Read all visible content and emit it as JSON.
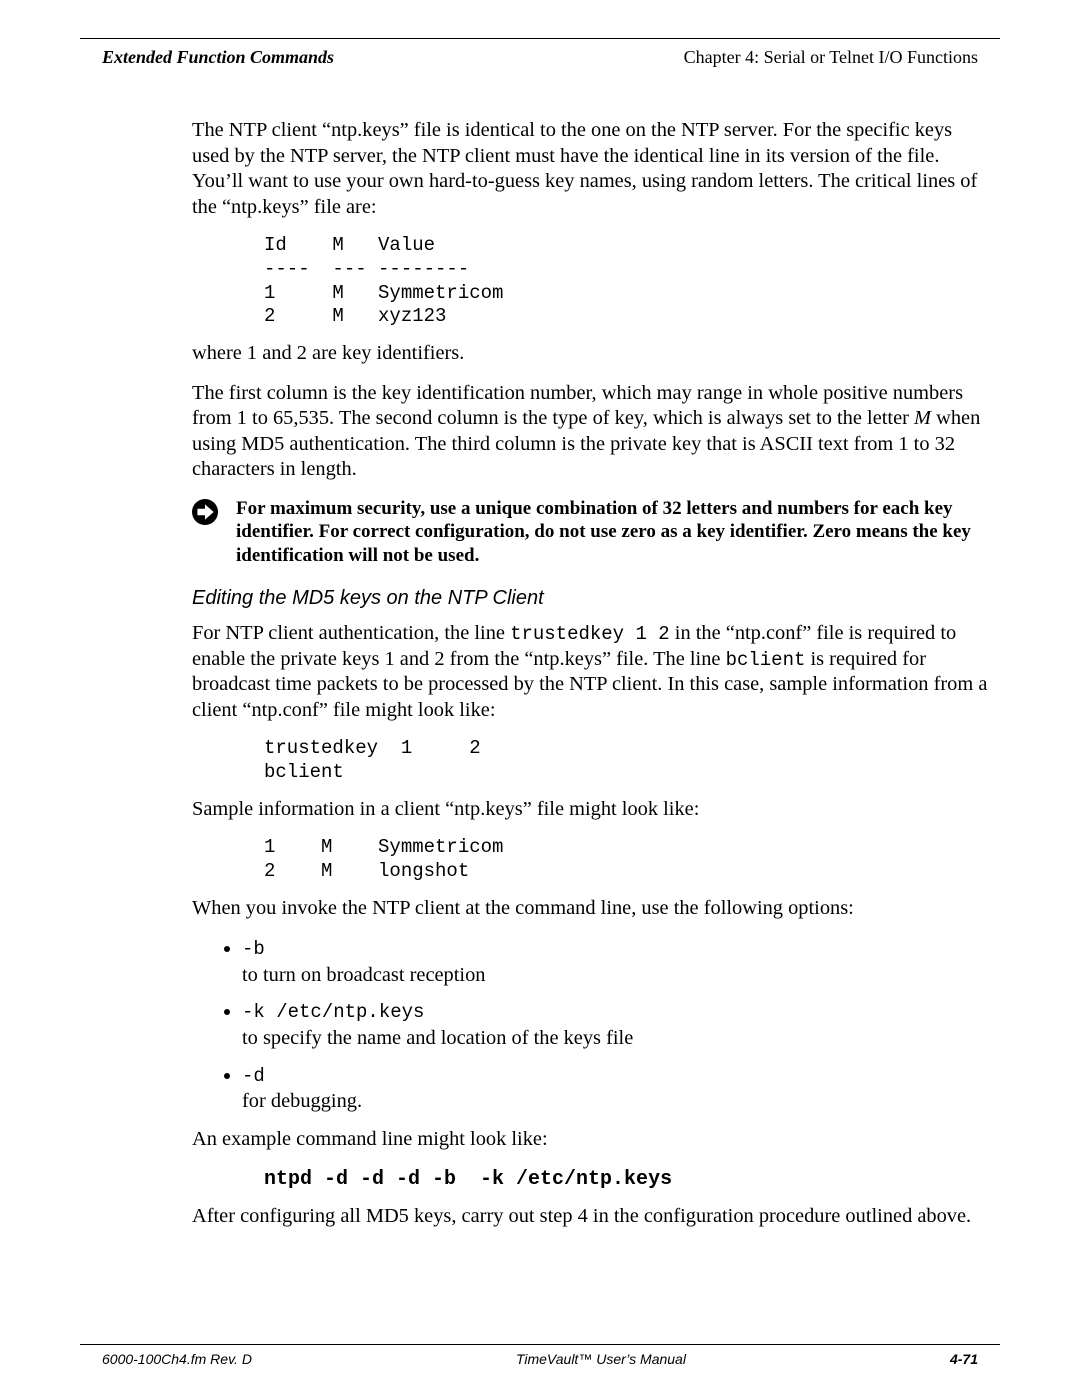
{
  "header": {
    "left": "Extended Function Commands",
    "right": "Chapter 4: Serial or Telnet I/O Functions"
  },
  "p1": "The NTP client “ntp.keys” file is identical to the one on the NTP server.  For the specific keys used by the NTP server, the NTP client must have the identical line in its version of the file.  You’ll want to use your own hard-to-guess key names, using random letters.  The critical lines of the “ntp.keys” file are:",
  "code1": "Id    M   Value\n----  --- --------\n1     M   Symmetricom\n2     M   xyz123",
  "p2": "where 1 and 2 are key identifiers.",
  "p3_a": "The first column is the key identification number, which may range in whole positive numbers from 1 to 65,535.  The second column is the type of key, which is always set to the letter ",
  "p3_m": "M",
  "p3_b": " when using MD5 authentication.  The third column is the private key that is ASCII text from 1 to 32 characters in length.",
  "note": "For  maximum security, use a unique combination of 32 letters and numbers for each key identifier.  For correct configuration, do not use zero as a key identifier.  Zero means the key identification will not be used.",
  "subhead": "Editing the MD5 keys on the NTP Client",
  "p4_a": "For NTP client authentication, the line ",
  "p4_code1": "trustedkey 1 2",
  "p4_b": " in the “ntp.conf” file is required to enable the private keys 1 and 2 from the “ntp.keys” file.  The line ",
  "p4_code2": "bclient",
  "p4_c": " is required for broadcast time packets to be processed by the NTP client.  In this case, sample information from a client “ntp.conf” file might look like:",
  "code2": "trustedkey  1     2\nbclient",
  "p5": "Sample information in a client “ntp.keys” file might look like:",
  "code3": "1    M    Symmetricom\n2    M    longshot",
  "p6": "When you invoke the NTP client at the command line, use the following options:",
  "opts": [
    {
      "code": "-b",
      "desc": "to turn on broadcast reception"
    },
    {
      "code": "-k /etc/ntp.keys",
      "desc": "to specify the name and location of the keys file"
    },
    {
      "code": "-d",
      "desc": "for debugging."
    }
  ],
  "p7": "An example command line might look like:",
  "cmd": "ntpd -d -d -d -b  -k /etc/ntp.keys",
  "p8": "After configuring all MD5 keys, carry out step 4 in the configuration procedure outlined above.",
  "footer": {
    "left": "6000-100Ch4.fm  Rev. D",
    "center": "TimeVault™ User’s Manual",
    "right": "4-71"
  }
}
